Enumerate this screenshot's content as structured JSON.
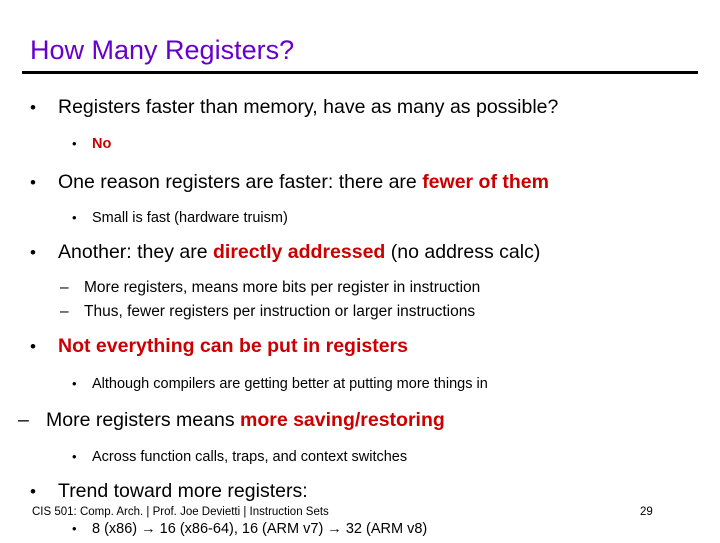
{
  "slide": {
    "title": "How Many Registers?",
    "title_color": "#6600CC",
    "accent_color": "#CC0000",
    "background_color": "#ffffff",
    "bullet_glyph": "•",
    "dash_glyph": "–",
    "arrow_glyph": "→",
    "content": [
      {
        "level": 1,
        "style": "bullet",
        "text": "Registers faster than memory, have as many as possible?"
      },
      {
        "level": 2,
        "style": "bullet",
        "text": "No",
        "emphasis": "all"
      },
      {
        "level": 1,
        "style": "bullet",
        "text_plain": "One reason registers are faster: there are ",
        "text_emphasis": "fewer of them"
      },
      {
        "level": 2,
        "style": "bullet",
        "text": "Small is fast (hardware truism)"
      },
      {
        "level": 1,
        "style": "bullet",
        "text_plain": "Another: they are ",
        "text_emphasis": "directly addressed",
        "text_plain_after": " (no address calc)"
      },
      {
        "level": 2,
        "style": "dash",
        "text": "More registers, means more bits per register in instruction"
      },
      {
        "level": 2,
        "style": "dash",
        "text": "Thus, fewer registers per instruction or larger instructions"
      },
      {
        "level": 1,
        "style": "bullet",
        "text": "Not everything can be put in registers",
        "emphasis": "all"
      },
      {
        "level": 2,
        "style": "bullet",
        "text": "Although compilers are getting better at putting more things in"
      },
      {
        "level": 1,
        "style": "dash-outer",
        "text_plain": "More registers means ",
        "text_emphasis": "more saving/restoring"
      },
      {
        "level": 2,
        "style": "bullet",
        "text": "Across function calls, traps, and context switches"
      },
      {
        "level": 1,
        "style": "bullet",
        "text": "Trend toward more registers:"
      },
      {
        "level": 2,
        "style": "bullet",
        "text": "8 (x86) → 16 (x86-64),  16 (ARM v7) → 32 (ARM v8)"
      }
    ]
  },
  "footer": {
    "text": "CIS 501: Comp. Arch.  |  Prof. Joe Devietti  |  Instruction Sets",
    "page_number": "29"
  }
}
